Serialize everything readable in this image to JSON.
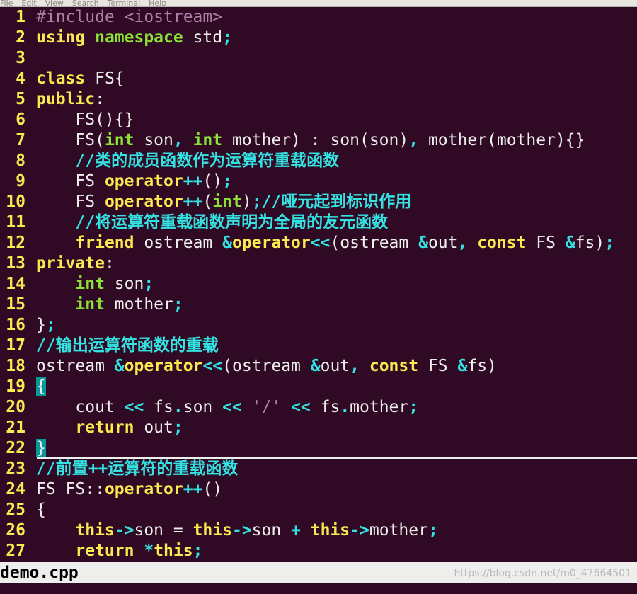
{
  "menubar": {
    "items": [
      "File",
      "Edit",
      "View",
      "Search",
      "Terminal",
      "Help"
    ]
  },
  "editor": {
    "lines": [
      {
        "n": "1",
        "tokens": [
          [
            "pp",
            "#include "
          ],
          [
            "pp",
            "<iostream>"
          ]
        ]
      },
      {
        "n": "2",
        "tokens": [
          [
            "kw",
            "using"
          ],
          [
            "",
            ""
          ],
          [
            "ty",
            " namespace"
          ],
          [
            "",
            " std"
          ],
          [
            "op",
            ";"
          ]
        ]
      },
      {
        "n": "3",
        "tokens": []
      },
      {
        "n": "4",
        "tokens": [
          [
            "kw",
            "class"
          ],
          [
            "",
            " FS{"
          ]
        ]
      },
      {
        "n": "5",
        "tokens": [
          [
            "kw",
            "public"
          ],
          [
            "",
            ":"
          ]
        ]
      },
      {
        "n": "6",
        "tokens": [
          [
            "",
            "    FS(){}"
          ]
        ]
      },
      {
        "n": "7",
        "tokens": [
          [
            "",
            "    FS("
          ],
          [
            "ty",
            "int"
          ],
          [
            "",
            " son"
          ],
          [
            "op",
            ","
          ],
          [
            "ty",
            " int"
          ],
          [
            "",
            " mother) : son(son)"
          ],
          [
            "op",
            ","
          ],
          [
            "",
            " mother(mother){}"
          ]
        ]
      },
      {
        "n": "8",
        "tokens": [
          [
            "cm",
            "    //类的成员函数作为运算符重载函数"
          ]
        ]
      },
      {
        "n": "9",
        "tokens": [
          [
            "",
            "    FS "
          ],
          [
            "kw",
            "operator"
          ],
          [
            "op",
            "++"
          ],
          [
            "",
            "()"
          ],
          [
            "op",
            ";"
          ]
        ]
      },
      {
        "n": "10",
        "tokens": [
          [
            "",
            "    FS "
          ],
          [
            "kw",
            "operator"
          ],
          [
            "op",
            "++"
          ],
          [
            "",
            "("
          ],
          [
            "ty",
            "int"
          ],
          [
            "",
            ")"
          ],
          [
            "op",
            ";"
          ],
          [
            "cm",
            "//哑元起到标识作用"
          ]
        ]
      },
      {
        "n": "11",
        "tokens": [
          [
            "cm",
            "    //将运算符重载函数声明为全局的友元函数"
          ]
        ]
      },
      {
        "n": "12",
        "tokens": [
          [
            "kw",
            "    friend"
          ],
          [
            "",
            " ostream "
          ],
          [
            "op",
            "&"
          ],
          [
            "kw",
            "operator"
          ],
          [
            "op",
            "<<"
          ],
          [
            "",
            "(ostream "
          ],
          [
            "op",
            "&"
          ],
          [
            "",
            "out"
          ],
          [
            "op",
            ","
          ],
          [
            "kw",
            " const"
          ],
          [
            "",
            " FS "
          ],
          [
            "op",
            "&"
          ],
          [
            "",
            "fs)"
          ],
          [
            "op",
            ";"
          ]
        ]
      },
      {
        "n": "13",
        "tokens": [
          [
            "kw",
            "private"
          ],
          [
            "",
            ":"
          ]
        ]
      },
      {
        "n": "14",
        "tokens": [
          [
            "ty",
            "    int"
          ],
          [
            "",
            " son"
          ],
          [
            "op",
            ";"
          ]
        ]
      },
      {
        "n": "15",
        "tokens": [
          [
            "ty",
            "    int"
          ],
          [
            "",
            " mother"
          ],
          [
            "op",
            ";"
          ]
        ]
      },
      {
        "n": "16",
        "tokens": [
          [
            "",
            "}"
          ],
          [
            "op",
            ";"
          ]
        ]
      },
      {
        "n": "17",
        "tokens": [
          [
            "cm",
            "//输出运算符函数的重载"
          ]
        ]
      },
      {
        "n": "18",
        "tokens": [
          [
            "",
            "ostream "
          ],
          [
            "op",
            "&"
          ],
          [
            "kw",
            "operator"
          ],
          [
            "op",
            "<<"
          ],
          [
            "",
            "(ostream "
          ],
          [
            "op",
            "&"
          ],
          [
            "",
            "out"
          ],
          [
            "op",
            ","
          ],
          [
            "kw",
            " const"
          ],
          [
            "",
            " FS "
          ],
          [
            "op",
            "&"
          ],
          [
            "",
            "fs)"
          ]
        ]
      },
      {
        "n": "19",
        "tokens": [
          [
            "cursor",
            "{"
          ]
        ]
      },
      {
        "n": "20",
        "tokens": [
          [
            "",
            "    cout "
          ],
          [
            "op",
            "<<"
          ],
          [
            "",
            " fs"
          ],
          [
            "op",
            "."
          ],
          [
            "",
            "son "
          ],
          [
            "op",
            "<<"
          ],
          [
            "st",
            " '/'"
          ],
          [
            "op",
            " <<"
          ],
          [
            "",
            " fs"
          ],
          [
            "op",
            "."
          ],
          [
            "",
            "mother"
          ],
          [
            "op",
            ";"
          ]
        ]
      },
      {
        "n": "21",
        "tokens": [
          [
            "kw",
            "    return"
          ],
          [
            "",
            " out"
          ],
          [
            "op",
            ";"
          ]
        ]
      },
      {
        "n": "22",
        "tokens": [
          [
            "cursor",
            "}"
          ]
        ],
        "rule": true
      },
      {
        "n": "23",
        "tokens": [
          [
            "cm",
            "//前置++运算符的重载函数"
          ]
        ]
      },
      {
        "n": "24",
        "tokens": [
          [
            "",
            "FS FS::"
          ],
          [
            "kw",
            "operator"
          ],
          [
            "op",
            "++"
          ],
          [
            "",
            "()"
          ]
        ]
      },
      {
        "n": "25",
        "tokens": [
          [
            "",
            "{"
          ]
        ]
      },
      {
        "n": "26",
        "tokens": [
          [
            "kw",
            "    this"
          ],
          [
            "op",
            "->"
          ],
          [
            "",
            "son = "
          ],
          [
            "kw",
            "this"
          ],
          [
            "op",
            "->"
          ],
          [
            "",
            "son "
          ],
          [
            "op",
            "+"
          ],
          [
            "kw",
            " this"
          ],
          [
            "op",
            "->"
          ],
          [
            "",
            "mother"
          ],
          [
            "op",
            ";"
          ]
        ]
      },
      {
        "n": "27",
        "tokens": [
          [
            "kw",
            "    return"
          ],
          [
            "op",
            " *"
          ],
          [
            "kw",
            "this"
          ],
          [
            "op",
            ";"
          ]
        ]
      }
    ]
  },
  "status": {
    "filename": "demo.cpp",
    "watermark": "https://blog.csdn.net/m0_47664501"
  }
}
